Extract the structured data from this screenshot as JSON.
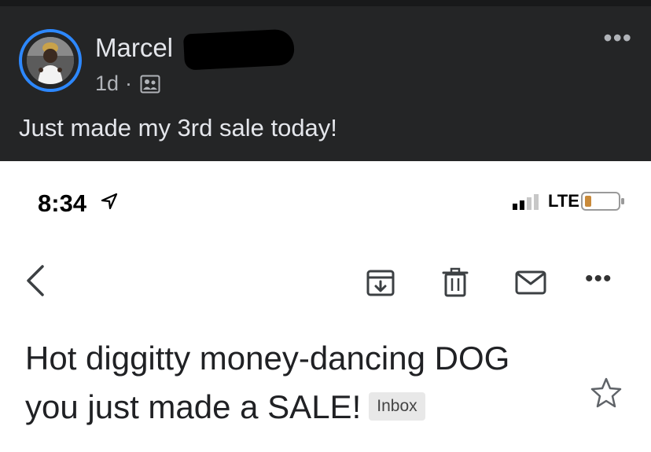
{
  "post": {
    "author_name": "Marcel",
    "time_ago": "1d",
    "separator": "·",
    "audience_icon": "friends-icon",
    "more_label": "•••",
    "text": "Just made my 3rd sale today!"
  },
  "phone_screenshot": {
    "status_bar": {
      "time": "8:34",
      "location_icon": "location-arrow-icon",
      "network": "LTE",
      "signal_icon": "signal-bars-icon",
      "battery_icon": "battery-icon"
    },
    "toolbar": {
      "back_icon": "chevron-left-icon",
      "archive_icon": "archive-icon",
      "delete_icon": "trash-icon",
      "unread_icon": "envelope-icon",
      "more_label": "•••"
    },
    "email": {
      "subject_line1": "Hot diggitty money-dancing DOG",
      "subject_line2": "you just made a SALE!",
      "label_badge": "Inbox",
      "star_icon": "star-icon"
    }
  },
  "colors": {
    "post_background": "#242526",
    "post_text": "#e4e6eb",
    "meta_text": "#b0b3b8",
    "avatar_ring": "#2d88ff",
    "battery_level": "#c98a3a"
  }
}
